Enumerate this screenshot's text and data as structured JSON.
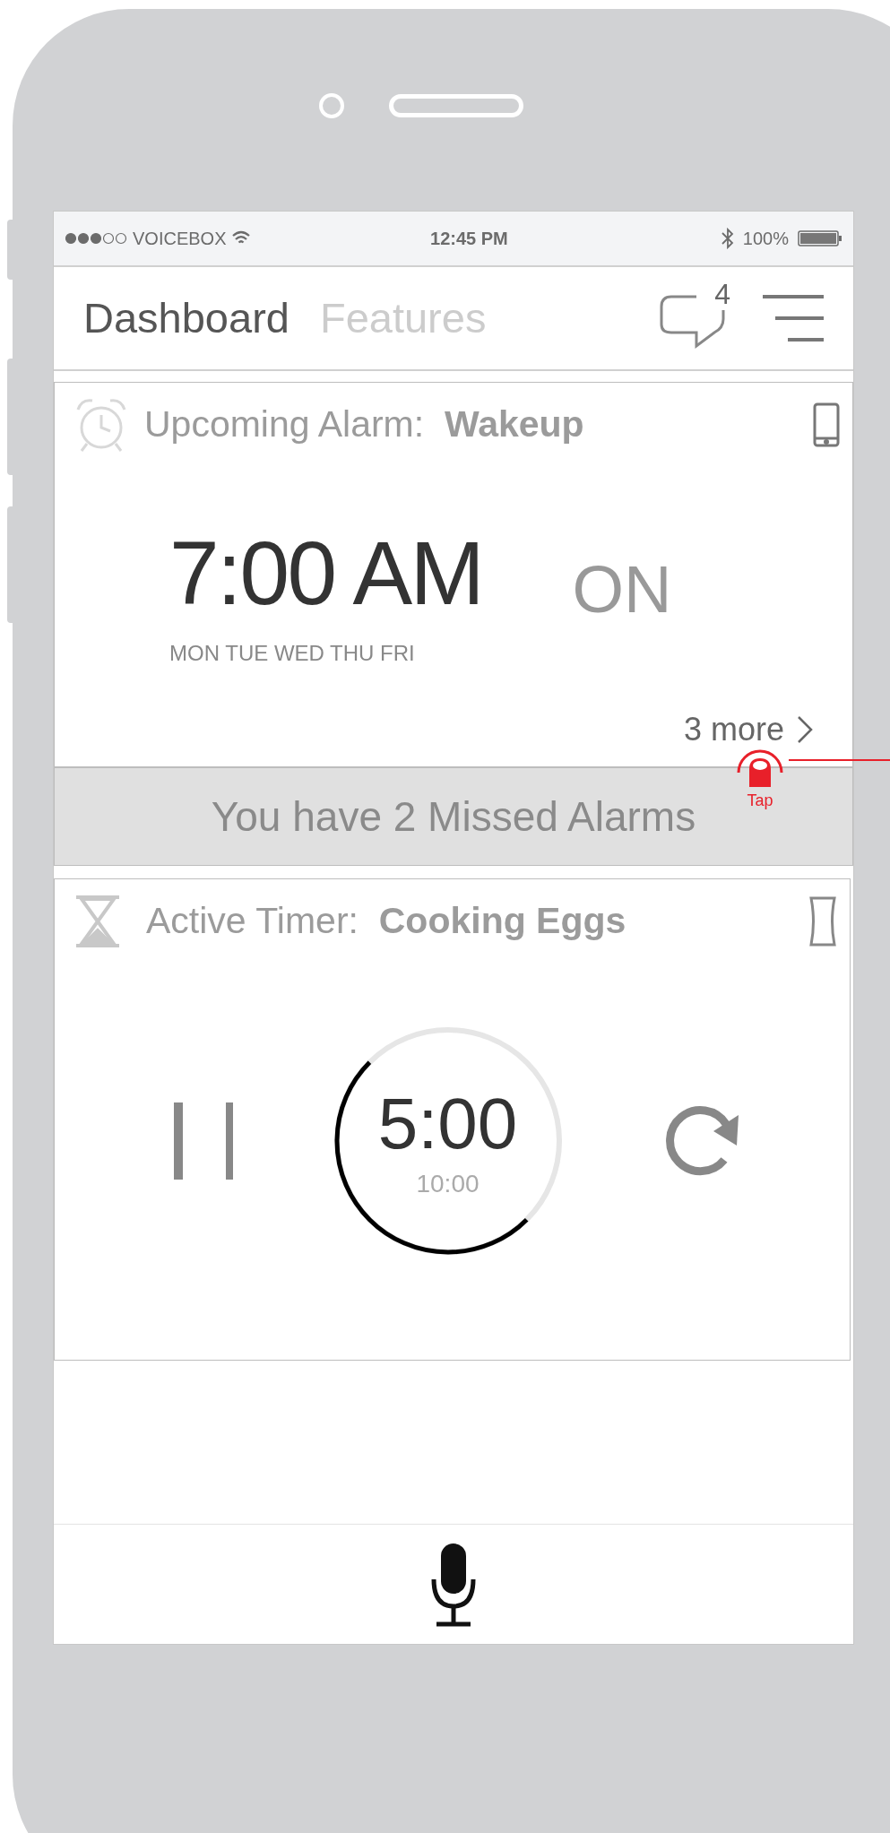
{
  "status_bar": {
    "carrier": "VOICEBOX",
    "time": "12:45 PM",
    "battery": "100%"
  },
  "tabs": [
    {
      "label": "Dashboard",
      "selected": true
    },
    {
      "label": "Features",
      "selected": false
    }
  ],
  "messages_badge": "4",
  "alarm_card": {
    "label": "Upcoming Alarm:",
    "name": "Wakeup",
    "time": "7:00 AM",
    "state": "ON",
    "days": "MON TUE WED THU FRI",
    "more": "3 more"
  },
  "missed_banner": "You have 2 Missed Alarms",
  "annotation": {
    "label": "Tap"
  },
  "timer_card": {
    "label": "Active Timer:",
    "name": "Cooking Eggs",
    "remaining": "5:00",
    "total": "10:00",
    "level": 0.5
  }
}
